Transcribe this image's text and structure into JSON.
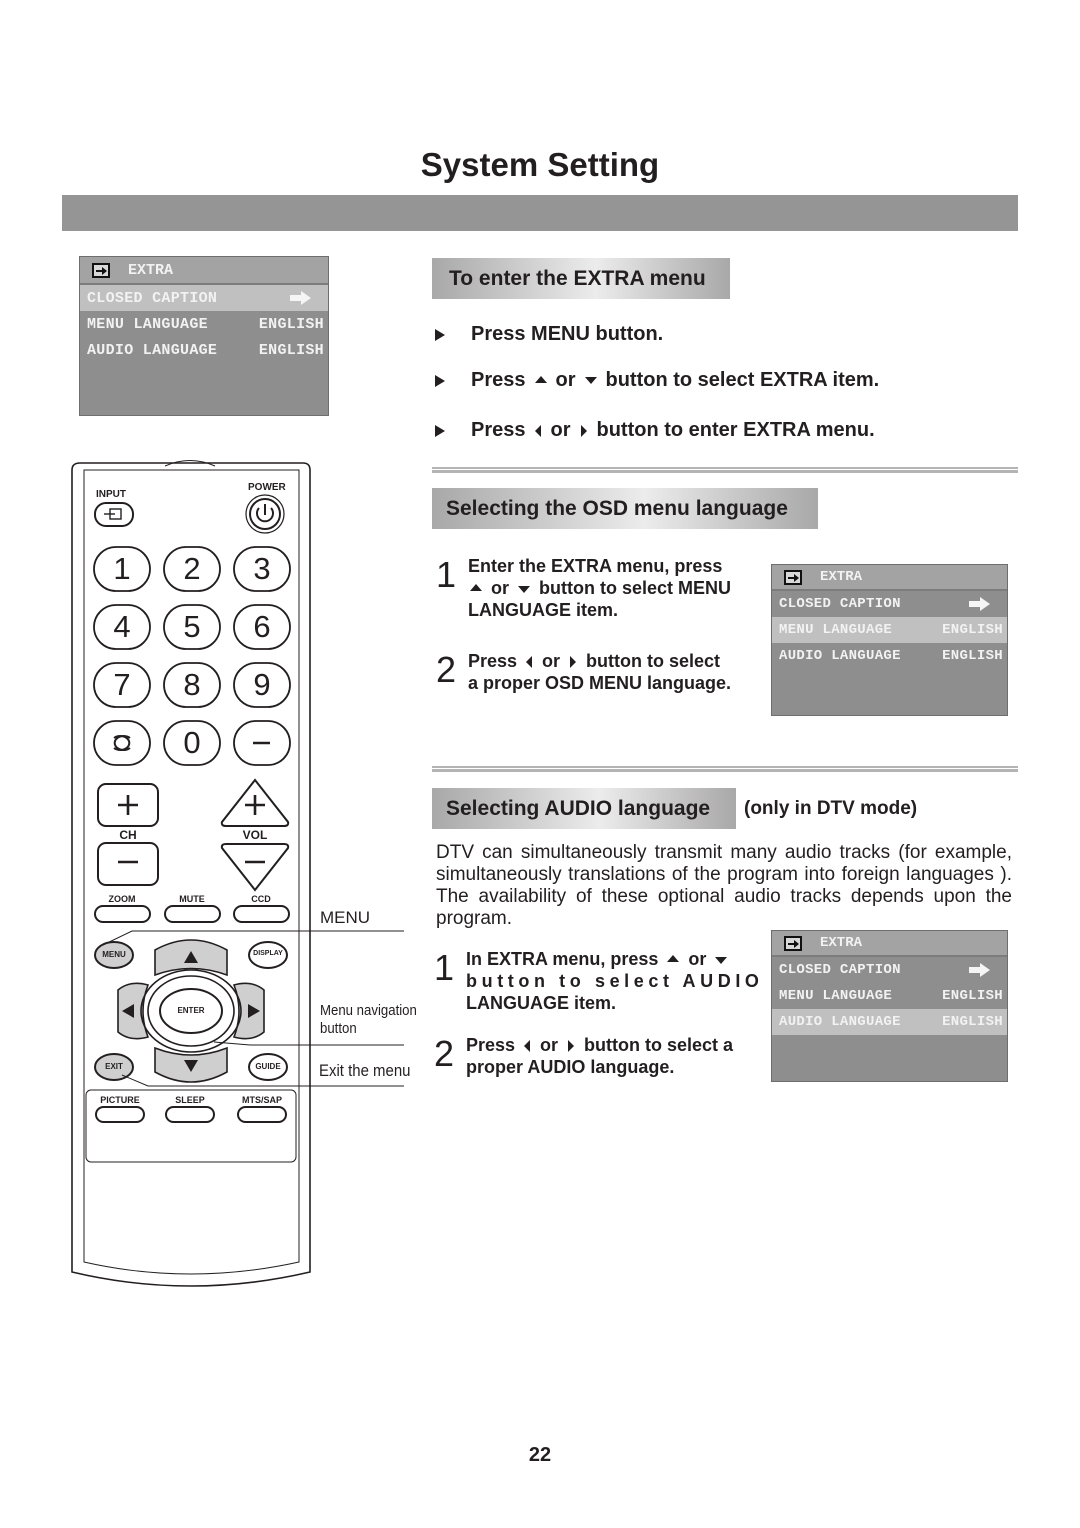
{
  "page": {
    "title": "System Setting",
    "page_number": "22"
  },
  "osd_menus": [
    {
      "header": "EXTRA",
      "header_icon": "extra-icon",
      "selected_row": 0,
      "rows": [
        {
          "label": "CLOSED CAPTION",
          "value": "",
          "icon": "right-arrow-icon"
        },
        {
          "label": "MENU LANGUAGE",
          "value": "ENGLISH"
        },
        {
          "label": "AUDIO LANGUAGE",
          "value": "ENGLISH"
        }
      ]
    },
    {
      "header": "EXTRA",
      "header_icon": "extra-icon",
      "selected_row": 1,
      "rows": [
        {
          "label": "CLOSED CAPTION",
          "value": "",
          "icon": "right-arrow-icon"
        },
        {
          "label": "MENU LANGUAGE",
          "value": "ENGLISH"
        },
        {
          "label": "AUDIO LANGUAGE",
          "value": "ENGLISH"
        }
      ]
    },
    {
      "header": "EXTRA",
      "header_icon": "extra-icon",
      "selected_row": 2,
      "rows": [
        {
          "label": "CLOSED CAPTION",
          "value": "",
          "icon": "right-arrow-icon"
        },
        {
          "label": "MENU LANGUAGE",
          "value": "ENGLISH"
        },
        {
          "label": "AUDIO LANGUAGE",
          "value": "ENGLISH"
        }
      ]
    }
  ],
  "enter_extra": {
    "heading": "To enter the EXTRA menu",
    "bullets": [
      {
        "parts": [
          "Press MENU button."
        ]
      },
      {
        "parts": [
          "Press",
          "or",
          "button to select EXTRA item."
        ],
        "icons": [
          "up-icon",
          "down-icon"
        ]
      },
      {
        "parts": [
          "Press",
          "or",
          "button to enter EXTRA menu."
        ],
        "icons": [
          "left-icon",
          "right-icon"
        ]
      }
    ]
  },
  "osd_language": {
    "heading": "Selecting the OSD menu language",
    "steps": [
      {
        "num": "1",
        "line1": "Enter the EXTRA menu, press",
        "mid1": "or",
        "mid2": "button to select MENU",
        "line3": "LANGUAGE item."
      },
      {
        "num": "2",
        "pre": "Press",
        "mid": "or",
        "post": "button to select",
        "line2": "a proper OSD MENU language."
      }
    ]
  },
  "audio_language": {
    "heading": "Selecting AUDIO language",
    "note": "(only in DTV mode)",
    "description": "DTV can simultaneously transmit many audio tracks (for example, simultaneously translations of the program into foreign languages ). The availability of these optional audio tracks depends upon the program.",
    "steps": [
      {
        "num": "1",
        "pre": "In EXTRA menu, press",
        "mid": "or",
        "line2": "button to select AUDIO",
        "line3": "LANGUAGE item."
      },
      {
        "num": "2",
        "pre": "Press",
        "mid": "or",
        "post": "button to select a",
        "line2": "proper AUDIO language."
      }
    ]
  },
  "remote": {
    "input_label": "INPUT",
    "power_label": "POWER",
    "digits": [
      "1",
      "2",
      "3",
      "4",
      "5",
      "6",
      "7",
      "8",
      "9",
      "0"
    ],
    "ch_label": "CH",
    "vol_label": "VOL",
    "row_labels_1": [
      "ZOOM",
      "MUTE",
      "CCD"
    ],
    "menu_label": "MENU",
    "display_label": "DISPLAY",
    "enter_label": "ENTER",
    "exit_label": "EXIT",
    "guide_label": "GUIDE",
    "row_labels_2": [
      "PICTURE",
      "SLEEP",
      "MTS/SAP"
    ]
  },
  "callouts": {
    "menu": "MENU",
    "nav_line1": "Menu navigation",
    "nav_line2": "button",
    "exit": "Exit the menu"
  }
}
